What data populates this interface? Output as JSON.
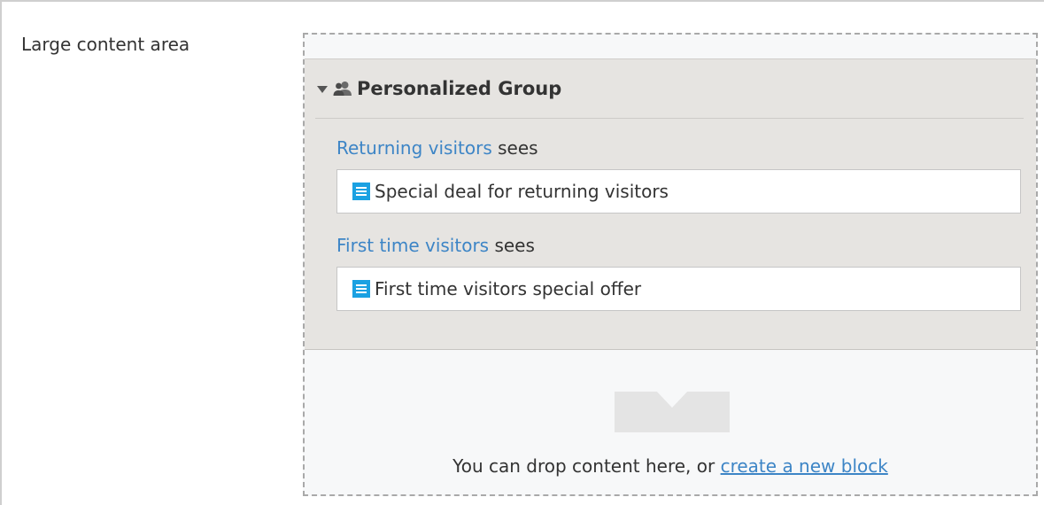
{
  "field": {
    "label": "Large content area"
  },
  "group": {
    "title": "Personalized Group",
    "variants": [
      {
        "audience": "Returning visitors",
        "suffix": " sees",
        "block": "Special deal for returning visitors"
      },
      {
        "audience": "First time visitors",
        "suffix": " sees",
        "block": "First time visitors special offer"
      }
    ]
  },
  "dropzone": {
    "text": "You can drop content here, or ",
    "link": "create a new block"
  },
  "icons": {
    "collapse": "triangle-down-icon",
    "group": "users-icon",
    "block": "block-icon",
    "drop": "drop-arrow-icon"
  },
  "colors": {
    "link": "#3d85c6",
    "block_icon": "#1ba1e2",
    "group_bg": "#e6e4e1"
  }
}
